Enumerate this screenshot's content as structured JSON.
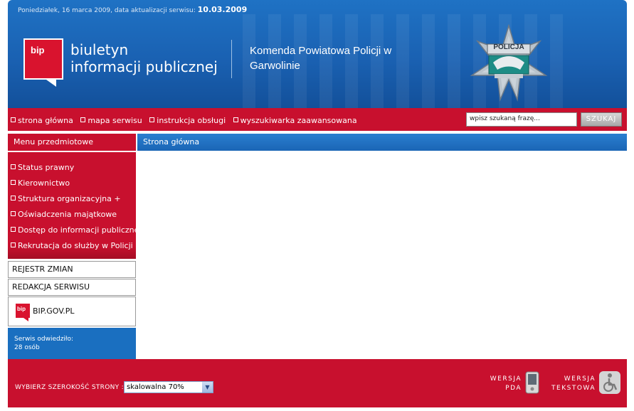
{
  "header": {
    "date_text": "Poniedziałek, 16 marca 2009, data aktualizacji serwisu:",
    "update_date": "10.03.2009",
    "logo_text": "bip",
    "biuletyn_line1": "biuletyn",
    "biuletyn_line2": "informacji publicznej",
    "org_line1": "Komenda Powiatowa Policji w",
    "org_line2": "Garwolinie",
    "badge_text": "POLICJA"
  },
  "nav": {
    "links": [
      "strona główna",
      "mapa serwisu",
      "instrukcja obsługi",
      "wyszukiwarka zaawansowana"
    ],
    "search_placeholder": "wpisz szukaną frazę...",
    "search_button": "SZUKAJ"
  },
  "sidebar": {
    "title": "Menu przedmiotowe",
    "items": [
      "Status prawny",
      "Kierownictwo",
      "Struktura organizacyjna +",
      "Oświadczenia majątkowe",
      "Dostęp do informacji publicznej",
      "Rekrutacja do służby w Policji"
    ],
    "rejestr": "REJESTR ZMIAN",
    "redakcja": "REDAKCJA SERWISU",
    "bip_gov": "BIP.GOV.PL",
    "visits_line1": "Serwis odwiedziło:",
    "visits_line2": "28 osób"
  },
  "main": {
    "title": "Strona główna"
  },
  "footer": {
    "width_label": "WYBIERZ SZEROKOŚĆ STRONY :",
    "width_value": "skalowalna 70%",
    "pda_line1": "WERSJA",
    "pda_line2": "PDA",
    "text_line1": "WERSJA",
    "text_line2": "TEKSTOWA"
  },
  "colors": {
    "red": "#c8102e",
    "blue": "#1a6fc0"
  }
}
